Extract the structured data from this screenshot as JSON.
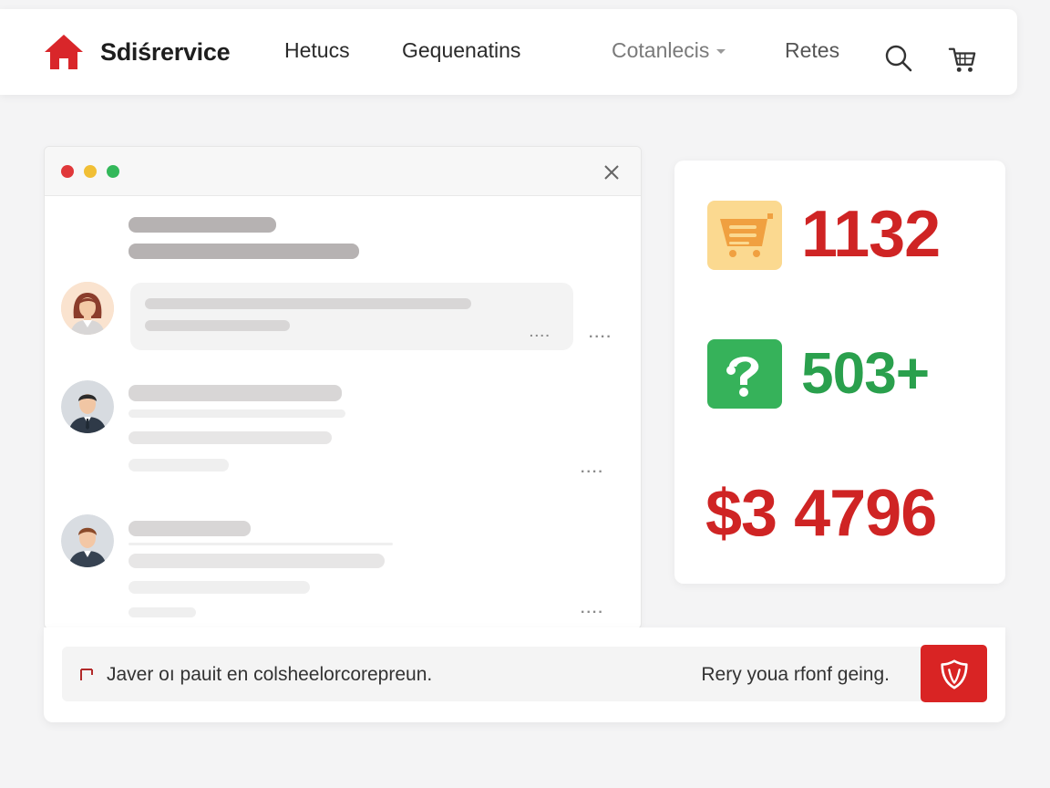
{
  "header": {
    "brand": "Sdiśrervice",
    "nav": [
      "Hetucs",
      "Gequenatins"
    ],
    "dropdown_label": "Cotanlecis",
    "link_right": "Retes",
    "icons": [
      "home-icon",
      "search-icon",
      "cart-icon"
    ]
  },
  "chat_window": {
    "controls": [
      "close-dot",
      "minimize-dot",
      "maximize-dot",
      "close-icon"
    ],
    "more_label": "....",
    "avatars": [
      "avatar-woman",
      "avatar-man-1",
      "avatar-man-2"
    ]
  },
  "stats": {
    "items": [
      {
        "icon": "cart-list-icon",
        "value": "1132",
        "color": "#cf2424"
      },
      {
        "icon": "help-icon",
        "value": "503+",
        "color": "#2aa04d"
      },
      {
        "icon": "",
        "value": "$3 4796",
        "color": "#cf2424"
      }
    ]
  },
  "composer": {
    "text": "Javer oı pauit en colsheelorcorepreun.",
    "hint": "Rery youa rfonf geing.",
    "send_icon": "shield-icon"
  },
  "colors": {
    "accent_red": "#d92424",
    "accent_green": "#36b25a",
    "accent_yellow": "#fbd990"
  }
}
